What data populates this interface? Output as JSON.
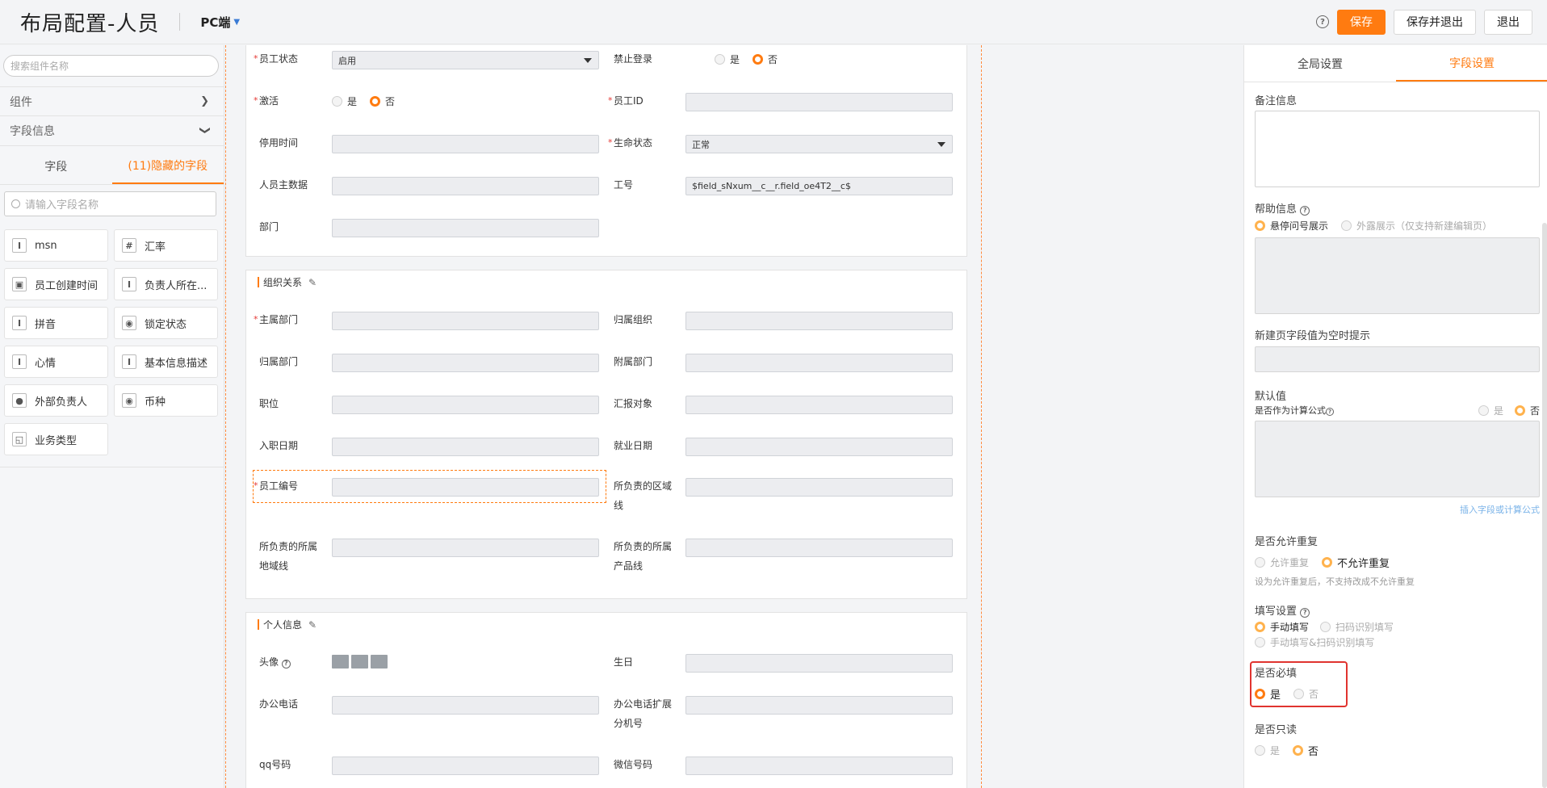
{
  "header": {
    "title": "布局配置-人员",
    "device": "PC端",
    "save": "保存",
    "save_exit": "保存并退出",
    "exit": "退出",
    "help": "?"
  },
  "left": {
    "search_placeholder": "搜索组件名称",
    "components": "组件",
    "field_info": "字段信息",
    "tab_fields": "字段",
    "tab_hidden": "(11)隐藏的字段",
    "field_search_placeholder": "请输入字段名称",
    "fields": [
      {
        "label": "msn",
        "icon": "text-icon",
        "glyph": "I"
      },
      {
        "label": "汇率",
        "icon": "number-icon",
        "glyph": "#"
      },
      {
        "label": "员工创建时间",
        "icon": "datetime-icon",
        "glyph": "▣"
      },
      {
        "label": "负责人所在...",
        "icon": "text-icon",
        "glyph": "I"
      },
      {
        "label": "拼音",
        "icon": "text-icon",
        "glyph": "I"
      },
      {
        "label": "锁定状态",
        "icon": "select-icon",
        "glyph": "◉"
      },
      {
        "label": "心情",
        "icon": "text-icon",
        "glyph": "I"
      },
      {
        "label": "基本信息描述",
        "icon": "text-icon",
        "glyph": "I"
      },
      {
        "label": "外部负责人",
        "icon": "person-icon",
        "glyph": "●"
      },
      {
        "label": "币种",
        "icon": "select-icon",
        "glyph": "◉"
      },
      {
        "label": "业务类型",
        "icon": "type-icon",
        "glyph": "◱"
      }
    ]
  },
  "form": {
    "top": {
      "employee_status": "员工状态",
      "employee_status_value": "启用",
      "login_ban": "禁止登录",
      "yes": "是",
      "no": "否",
      "activate": "激活",
      "employee_id": "员工ID",
      "disable_time": "停用时间",
      "life_status": "生命状态",
      "life_status_value": "正常",
      "master_data": "人员主数据",
      "job_no": "工号",
      "job_no_value": "$field_sNxum__c__r.field_oe4T2__c$",
      "dept": "部门"
    },
    "org": {
      "title": "组织关系",
      "main_dept": "主属部门",
      "belong_org": "归属组织",
      "belong_dept": "归属部门",
      "sub_dept": "附属部门",
      "position": "职位",
      "report_to": "汇报对象",
      "join_date": "入职日期",
      "work_date": "就业日期",
      "emp_no": "员工编号",
      "region_line_1": "所负责的区域",
      "region_line_2": "线",
      "territory_1": "所负责的所属",
      "territory_2": "地域线",
      "product_1": "所负责的所属",
      "product_2": "产品线"
    },
    "personal": {
      "title": "个人信息",
      "avatar": "头像",
      "birthday": "生日",
      "office_phone": "办公电话",
      "ext_1": "办公电话扩展",
      "ext_2": "分机号",
      "qq": "qq号码",
      "wechat": "微信号码"
    }
  },
  "right": {
    "tab_global": "全局设置",
    "tab_field": "字段设置",
    "remark": "备注信息",
    "help_info": "帮助信息",
    "hover_show": "悬停问号展示",
    "outside_show": "外露展示（仅支持新建编辑页）",
    "empty_hint": "新建页字段值为空时提示",
    "default_value": "默认值",
    "is_formula": "是否作为计算公式",
    "yes": "是",
    "no": "否",
    "insert_link": "插入字段或计算公式",
    "allow_dup": "是否允许重复",
    "allow": "允许重复",
    "disallow": "不允许重复",
    "dup_hint": "设为允许重复后，不支持改成不允许重复",
    "fill_setting": "填写设置",
    "manual": "手动填写",
    "scan": "扫码识别填写",
    "manual_scan": "手动填写&扫码识别填写",
    "required": "是否必填",
    "readonly": "是否只读"
  },
  "colors": {
    "accent": "#ff7b10",
    "highlight": "#e0342f",
    "link": "#7ab3e8"
  }
}
